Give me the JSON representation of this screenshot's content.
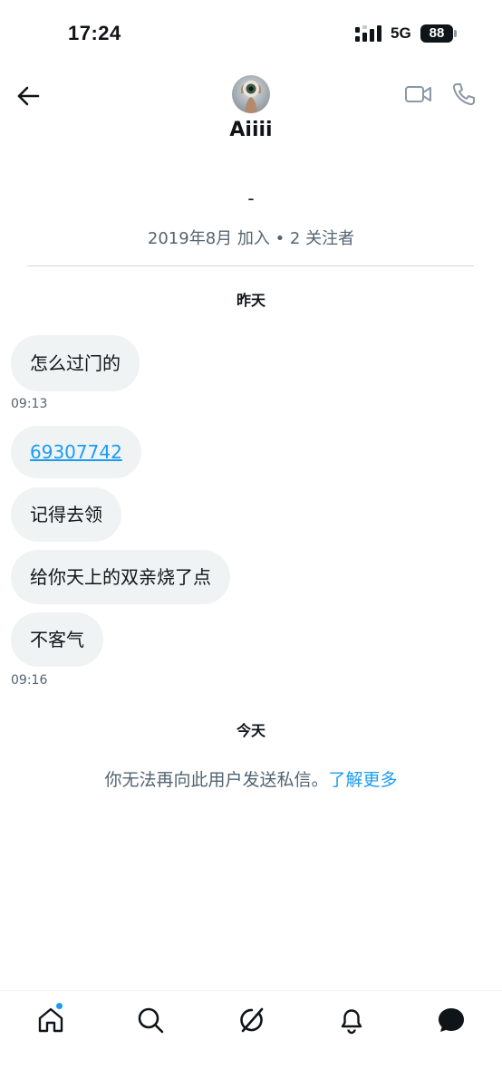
{
  "status_bar": {
    "time": "17:24",
    "network": "5G",
    "battery": "88"
  },
  "header": {
    "name": "Aiiii",
    "back_icon": "arrow-left-icon",
    "video_icon": "video-camera-icon",
    "call_icon": "phone-icon"
  },
  "profile": {
    "bio": "-",
    "meta": "2019年8月 加入 • 2 关注者"
  },
  "conversation": {
    "day_yesterday": "昨天",
    "messages": [
      {
        "text": "怎么过门的"
      },
      {
        "text": "69307742"
      },
      {
        "text": "记得去领"
      },
      {
        "text": "给你天上的双亲烧了点"
      },
      {
        "text": "不客气"
      }
    ],
    "timestamps": [
      "09:13",
      "09:16"
    ],
    "day_today": "今天"
  },
  "notice": {
    "text": "你无法再向此用户发送私信。",
    "link": "了解更多"
  },
  "bottom_nav": {
    "items": [
      "home-icon",
      "search-icon",
      "grok-icon",
      "notifications-bell-icon",
      "messages-icon"
    ],
    "home_badge": true
  },
  "colors": {
    "accent": "#1d9bf0",
    "bubble": "#eff3f4",
    "secondary_text": "#536471",
    "divider": "#cfd9de"
  }
}
